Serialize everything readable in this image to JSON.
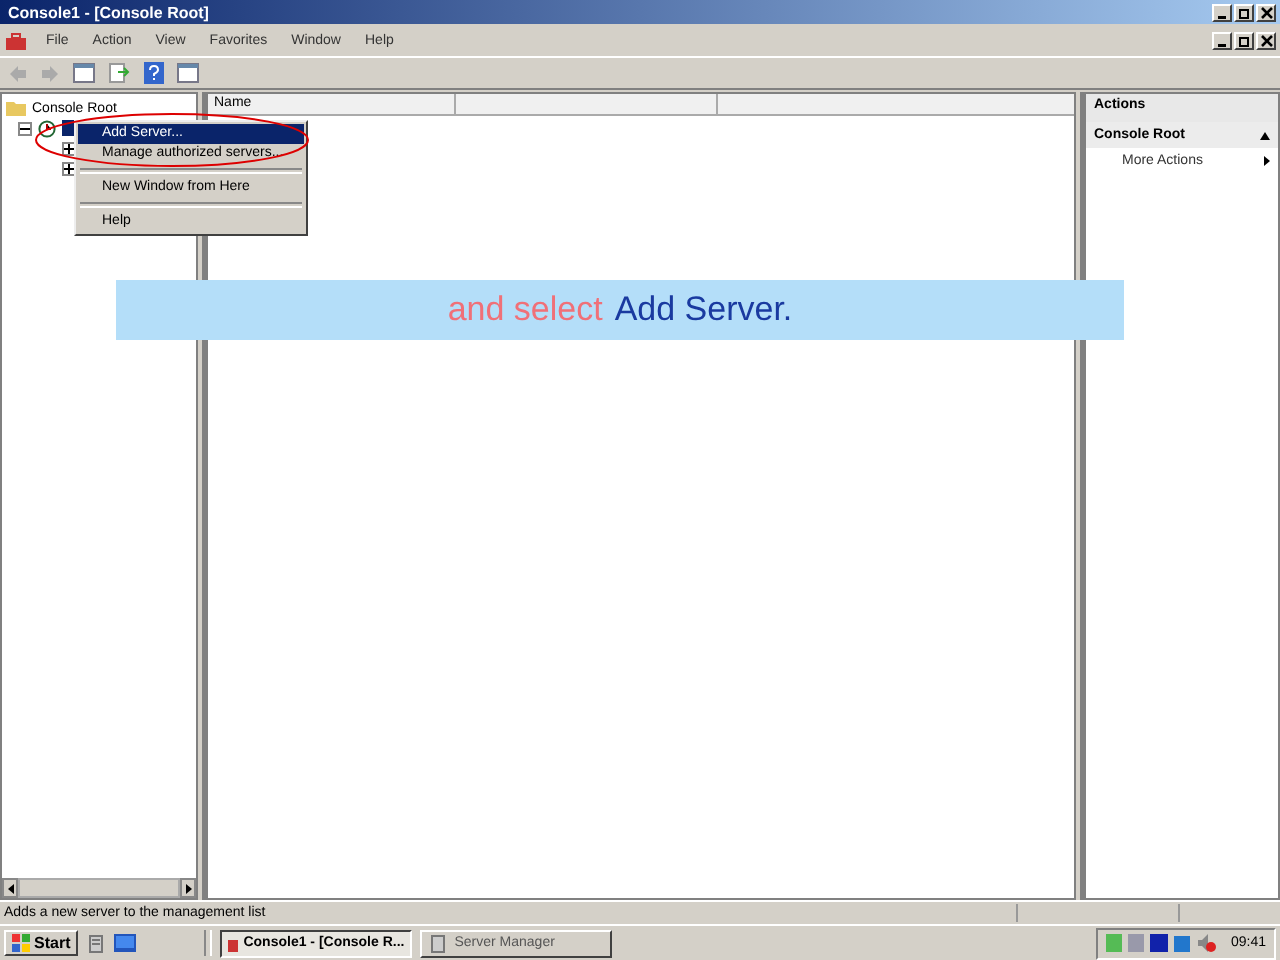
{
  "window": {
    "title": "Console1 - [Console Root]"
  },
  "menu_bar": [
    "File",
    "Action",
    "View",
    "Favorites",
    "Window",
    "Help"
  ],
  "tree": {
    "label": "Console Root",
    "children": [
      {
        "selected": true,
        "children": [
          {
            "expanded": false
          },
          {
            "expanded": false
          }
        ]
      }
    ]
  },
  "list": {
    "columns": [
      "Name"
    ]
  },
  "actions": {
    "title": "Actions",
    "section": "Console Root",
    "items": [
      "More Actions"
    ]
  },
  "context_menu": [
    {
      "label": "Add Server...",
      "selected": true
    },
    {
      "label": "Manage authorized servers...",
      "selected": false
    },
    {
      "kind": "separator"
    },
    {
      "label": "New Window from Here",
      "selected": false
    },
    {
      "kind": "separator"
    },
    {
      "label": "Help",
      "selected": false
    }
  ],
  "caption": {
    "prefix": "and select",
    "highlight": "Add Server."
  },
  "status_bar": "Adds a new server to the management list",
  "taskbar": {
    "start": "Start",
    "tasks": [
      {
        "label": "Console1 - [Console R...",
        "selected": true
      },
      {
        "label": "Server Manager",
        "selected": false
      }
    ],
    "clock": "09:41"
  }
}
